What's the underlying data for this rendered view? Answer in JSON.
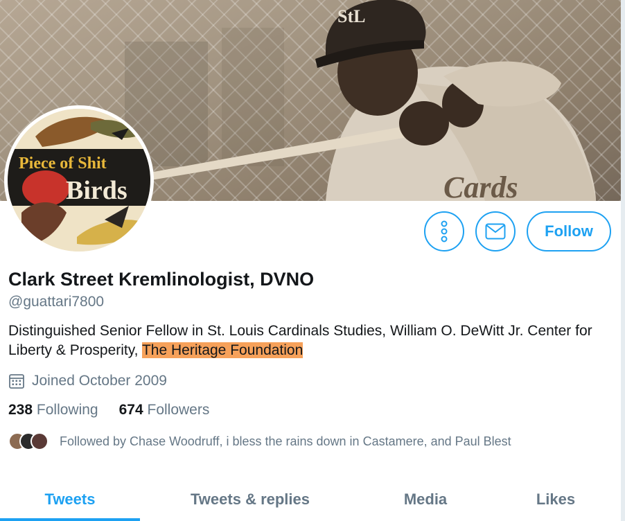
{
  "profile": {
    "display_name": "Clark Street Kremlinologist, DVNO",
    "handle": "@guattari7800",
    "bio_prefix": "Distinguished Senior Fellow in St. Louis Cardinals Studies, William O. DeWitt Jr. Center for Liberty & Prosperity, ",
    "bio_highlight": "The Heritage Foundation",
    "joined": "Joined October 2009"
  },
  "avatar": {
    "title_line1": "Piece of Shit",
    "title_line2": "Birds"
  },
  "actions": {
    "follow_label": "Follow"
  },
  "stats": {
    "following_count": "238",
    "following_label": "Following",
    "followers_count": "674",
    "followers_label": "Followers"
  },
  "followed_by": "Followed by Chase Woodruff, i bless the rains down in Castamere, and Paul Blest",
  "tabs": [
    {
      "label": "Tweets",
      "active": true
    },
    {
      "label": "Tweets & replies",
      "active": false
    },
    {
      "label": "Media",
      "active": false
    },
    {
      "label": "Likes",
      "active": false
    }
  ],
  "colors": {
    "accent": "#1da1f2",
    "secondary_text": "#657786",
    "highlight": "#f6a15a"
  },
  "icons": [
    "more-icon",
    "mail-icon",
    "calendar-icon"
  ]
}
